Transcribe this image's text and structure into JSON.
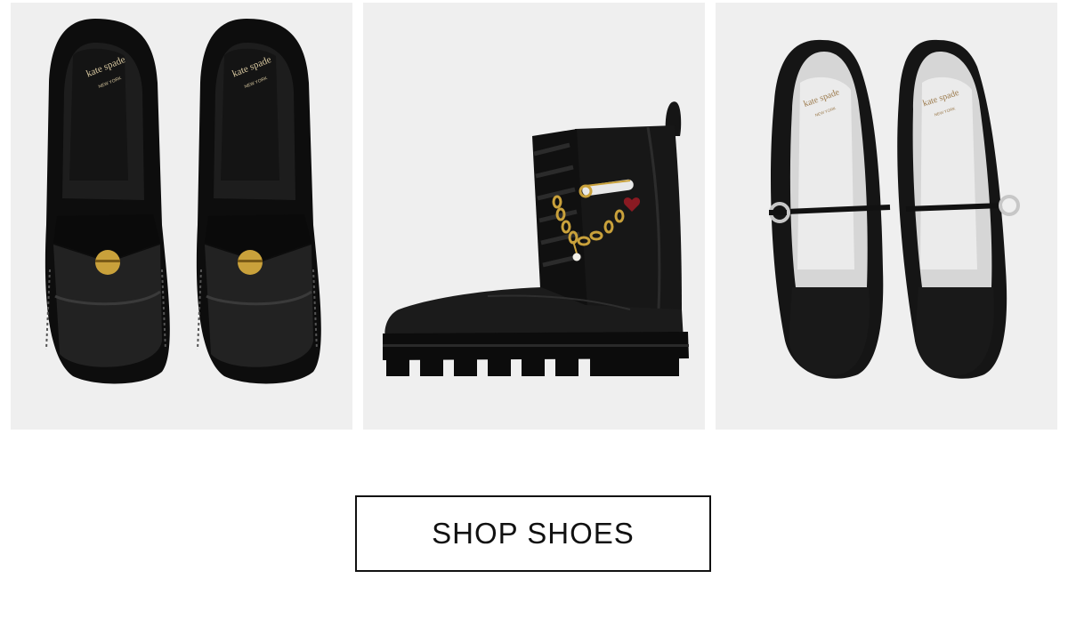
{
  "products": [
    {
      "name": "loafers",
      "brand_mark": "kate spade",
      "brand_sub": "NEW YORK"
    },
    {
      "name": "combat-boot"
    },
    {
      "name": "mary-jane-flats",
      "brand_mark": "kate spade",
      "brand_sub": "NEW YORK"
    }
  ],
  "cta": {
    "label": "SHOP SHOES"
  },
  "colors": {
    "tile_bg": "#efefef",
    "shoe": "#141414",
    "gold": "#c9a13b",
    "silver": "#d9d9d9"
  }
}
